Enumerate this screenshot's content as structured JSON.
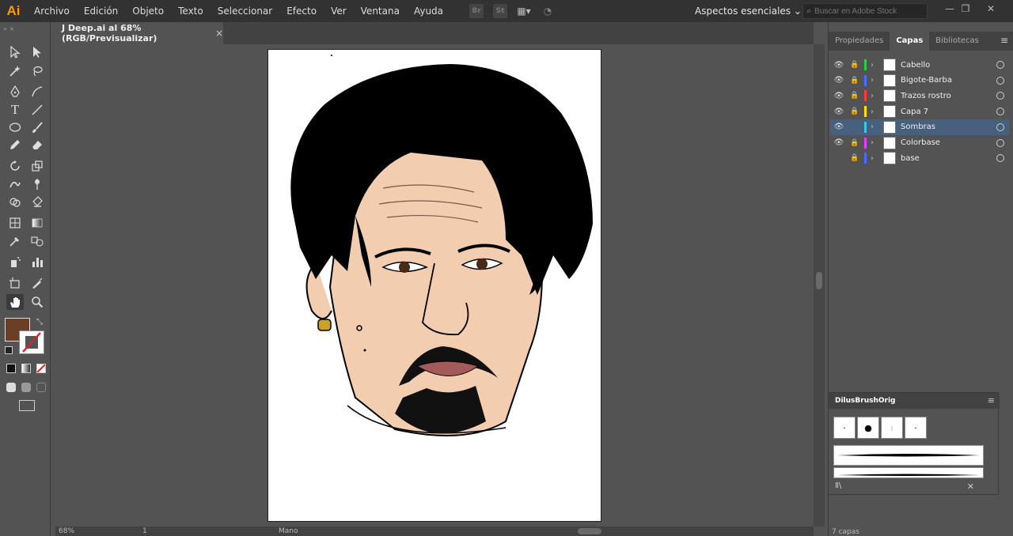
{
  "app": {
    "logo": "Ai"
  },
  "menu": [
    "Archivo",
    "Edición",
    "Objeto",
    "Texto",
    "Seleccionar",
    "Efecto",
    "Ver",
    "Ventana",
    "Ayuda"
  ],
  "menubar_icons": [
    "Br",
    "St"
  ],
  "workspace": "Aspectos esenciales",
  "search": {
    "placeholder": "Buscar en Adobe Stock"
  },
  "document_tab": {
    "title": "J Deep.ai al 68% (RGB/Previsualizar)",
    "close": "×"
  },
  "status": {
    "zoom": "68%",
    "page": "1",
    "tool": "Mano"
  },
  "panel_tabs": [
    "Propiedades",
    "Capas",
    "Bibliotecas"
  ],
  "layers": [
    {
      "name": "Cabello",
      "color": "#2ecc40",
      "visible": true,
      "locked": true,
      "selected": false
    },
    {
      "name": "Bigote-Barba",
      "color": "#4d6bff",
      "visible": true,
      "locked": true,
      "selected": false
    },
    {
      "name": "Trazos rostro",
      "color": "#ff3b3b",
      "visible": true,
      "locked": true,
      "selected": false
    },
    {
      "name": "Capa 7",
      "color": "#ffe000",
      "visible": true,
      "locked": true,
      "selected": false
    },
    {
      "name": "Sombras",
      "color": "#38c8e6",
      "visible": true,
      "locked": false,
      "selected": true
    },
    {
      "name": "Colorbase",
      "color": "#e040ff",
      "visible": true,
      "locked": true,
      "selected": false
    },
    {
      "name": "base",
      "color": "#4d6bff",
      "visible": false,
      "locked": true,
      "selected": false
    }
  ],
  "layers_count": "7 capas",
  "brush_panel": {
    "title": "DilusBrushOrig"
  },
  "colors": {
    "fill": "#6b3e26",
    "accent": "#ff9a00",
    "selection": "#46607e"
  }
}
